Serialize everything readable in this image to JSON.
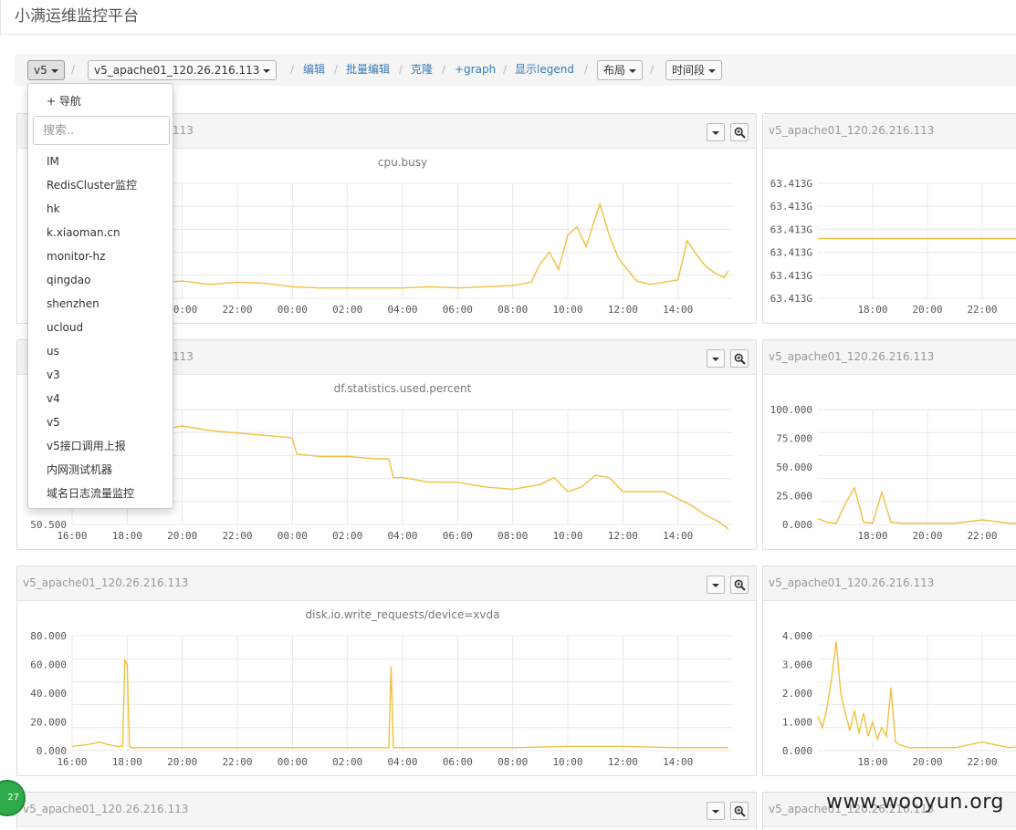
{
  "app": {
    "title": "小满运维监控平台"
  },
  "toolbar": {
    "group_selected": "v5",
    "host_selected": "v5_apache01_120.26.216.113",
    "separator": "/",
    "edit": "编辑",
    "batch_edit": "批量编辑",
    "clone": "克隆",
    "add_graph": "+graph",
    "show_legend": "显示legend",
    "layout": "布局",
    "time_range": "时间段"
  },
  "dropdown": {
    "nav_label": "+ 导航",
    "search_placeholder": "搜索..",
    "items": [
      "IM",
      "RedisCluster监控",
      "hk",
      "k.xiaoman.cn",
      "monitor-hz",
      "qingdao",
      "shenzhen",
      "ucloud",
      "us",
      "v3",
      "v4",
      "v5",
      "v5接口调用上报",
      "内网测试机器",
      "域名日志流量监控"
    ]
  },
  "icons": {
    "caret": "chevron-down-icon",
    "zoom": "zoom-icon"
  },
  "colors": {
    "series": "#f0c040",
    "grid": "#e8e8e8"
  },
  "panels": [
    {
      "title": "v5_apache01_120.26.216.113",
      "visible_title": "113",
      "metric": "cpu.busy"
    },
    {
      "title": "v5_apache01_120.26.216.113",
      "metric": ""
    },
    {
      "title": "v5_apache01_120.26.216.113",
      "visible_title": "113",
      "metric": "df.statistics.used.percent"
    },
    {
      "title": "v5_apache01_120.26.216.113",
      "metric": ""
    },
    {
      "title": "v5_apache01_120.26.216.113",
      "metric": "disk.io.write_requests/device=xvda"
    },
    {
      "title": "v5_apache01_120.26.216.113",
      "metric": ""
    },
    {
      "title": "v5_apache01_120.26.216.113",
      "metric": ""
    },
    {
      "title": "v5_apache01_120.26.216.113",
      "metric": ""
    }
  ],
  "chart_data": [
    {
      "type": "line",
      "title": "cpu.busy",
      "x_ticks": [
        "20:00",
        "22:00",
        "00:00",
        "02:00",
        "04:00",
        "06:00",
        "08:00",
        "10:00",
        "12:00",
        "14:00",
        "16:00"
      ],
      "y_ticks": [],
      "series": [
        {
          "x": [
            "18:00",
            "19:00",
            "20:00",
            "21:00",
            "22:00",
            "23:00",
            "00:00",
            "01:00",
            "02:00",
            "03:00",
            "04:00",
            "05:00",
            "06:00",
            "07:00",
            "08:00",
            "08:40",
            "09:00",
            "09:20",
            "09:40",
            "10:00",
            "10:20",
            "10:40",
            "11:00",
            "11:10",
            "11:30",
            "11:50",
            "12:10",
            "12:30",
            "13:00",
            "13:30",
            "14:00",
            "14:20",
            "14:40",
            "15:00",
            "15:20",
            "15:40",
            "15:50"
          ],
          "y": [
            14,
            13,
            15,
            12,
            14,
            13,
            10,
            9,
            9,
            9,
            9,
            10,
            9,
            10,
            11,
            14,
            30,
            40,
            25,
            55,
            62,
            45,
            70,
            82,
            55,
            35,
            25,
            15,
            12,
            14,
            16,
            50,
            38,
            28,
            22,
            18,
            24
          ]
        }
      ]
    },
    {
      "type": "line",
      "title": "",
      "x_ticks": [
        "18:00",
        "20:00",
        "22:00"
      ],
      "y_ticks": [
        "63.413G",
        "63.413G",
        "63.413G",
        "63.413G",
        "63.413G",
        "63.413G"
      ],
      "series": [
        {
          "x": [
            "16:00",
            "23:59"
          ],
          "y": [
            63.413,
            63.413
          ]
        }
      ]
    },
    {
      "type": "line",
      "title": "df.statistics.used.percent",
      "x_ticks": [
        "18:00",
        "20:00",
        "22:00",
        "00:00",
        "02:00",
        "04:00",
        "06:00",
        "08:00",
        "10:00",
        "12:00",
        "14:00",
        "16:00"
      ],
      "y_ticks": [
        "50.500"
      ],
      "series": [
        {
          "x": [
            "18:00",
            "19:00",
            "20:00",
            "21:00",
            "22:00",
            "23:00",
            "23:59",
            "00:10",
            "01:00",
            "02:00",
            "03:00",
            "03:30",
            "03:40",
            "04:00",
            "05:00",
            "06:00",
            "07:00",
            "08:00",
            "09:00",
            "09:30",
            "10:00",
            "10:30",
            "11:00",
            "11:30",
            "12:00",
            "13:00",
            "13:30",
            "14:00",
            "14:30",
            "15:00",
            "15:30",
            "15:50"
          ],
          "y": [
            54.3,
            54.5,
            54.7,
            54.5,
            54.4,
            54.3,
            54.2,
            53.5,
            53.4,
            53.4,
            53.3,
            53.3,
            52.5,
            52.5,
            52.3,
            52.3,
            52.1,
            52.0,
            52.2,
            52.5,
            51.9,
            52.1,
            52.6,
            52.5,
            51.9,
            51.9,
            51.9,
            51.6,
            51.3,
            50.9,
            50.6,
            50.3
          ]
        }
      ]
    },
    {
      "type": "line",
      "title": "",
      "x_ticks": [
        "18:00",
        "20:00",
        "22:00"
      ],
      "y_ticks": [
        "100.000",
        "75.000",
        "50.000",
        "25.000",
        "0.000"
      ],
      "series": [
        {
          "x": [
            "16:00",
            "16:20",
            "16:40",
            "17:00",
            "17:20",
            "17:40",
            "18:00",
            "18:20",
            "18:40",
            "19:00",
            "19:20",
            "20:00",
            "21:00",
            "22:00",
            "23:00",
            "23:59"
          ],
          "y": [
            5,
            2,
            1,
            18,
            32,
            2,
            1,
            28,
            2,
            1,
            1,
            1,
            1,
            4,
            1,
            1
          ]
        }
      ]
    },
    {
      "type": "line",
      "title": "disk.io.write_requests/device=xvda",
      "x_ticks": [
        "18:00",
        "20:00",
        "22:00",
        "00:00",
        "02:00",
        "04:00",
        "06:00",
        "08:00",
        "10:00",
        "12:00",
        "14:00",
        "16:00"
      ],
      "y_ticks": [
        "80.000",
        "60.000",
        "40.000",
        "20.000",
        "0.000"
      ],
      "series": [
        {
          "x": [
            "16:00",
            "16:30",
            "17:00",
            "17:20",
            "17:40",
            "17:50",
            "17:55",
            "18:00",
            "18:05",
            "18:10",
            "20:00",
            "22:00",
            "00:00",
            "02:00",
            "03:20",
            "03:30",
            "03:35",
            "03:40",
            "04:00",
            "06:00",
            "08:00",
            "10:00",
            "12:00",
            "14:00",
            "15:50"
          ],
          "y": [
            3,
            4,
            6,
            4,
            3,
            3,
            63,
            60,
            3,
            2,
            2,
            2,
            2,
            2,
            2,
            2,
            59,
            2,
            2,
            2,
            2,
            3,
            3,
            2,
            2
          ]
        }
      ]
    },
    {
      "type": "line",
      "title": "",
      "x_ticks": [
        "18:00",
        "20:00",
        "22:00"
      ],
      "y_ticks": [
        "4.000",
        "3.000",
        "2.000",
        "1.000",
        "0.000"
      ],
      "series": [
        {
          "x": [
            "16:00",
            "16:10",
            "16:20",
            "16:30",
            "16:40",
            "16:50",
            "17:00",
            "17:10",
            "17:20",
            "17:30",
            "17:40",
            "17:50",
            "18:00",
            "18:10",
            "18:20",
            "18:30",
            "18:40",
            "18:50",
            "19:00",
            "19:20",
            "20:00",
            "21:00",
            "22:00",
            "23:00",
            "23:59"
          ],
          "y": [
            1.2,
            0.8,
            1.5,
            2.5,
            3.8,
            2.0,
            1.3,
            0.7,
            1.4,
            0.6,
            1.3,
            0.5,
            1.0,
            0.4,
            0.8,
            0.5,
            2.2,
            0.3,
            0.2,
            0.1,
            0.1,
            0.1,
            0.3,
            0.1,
            0.2
          ]
        }
      ]
    }
  ],
  "badge": "27",
  "watermark": "www.wooyun.org"
}
